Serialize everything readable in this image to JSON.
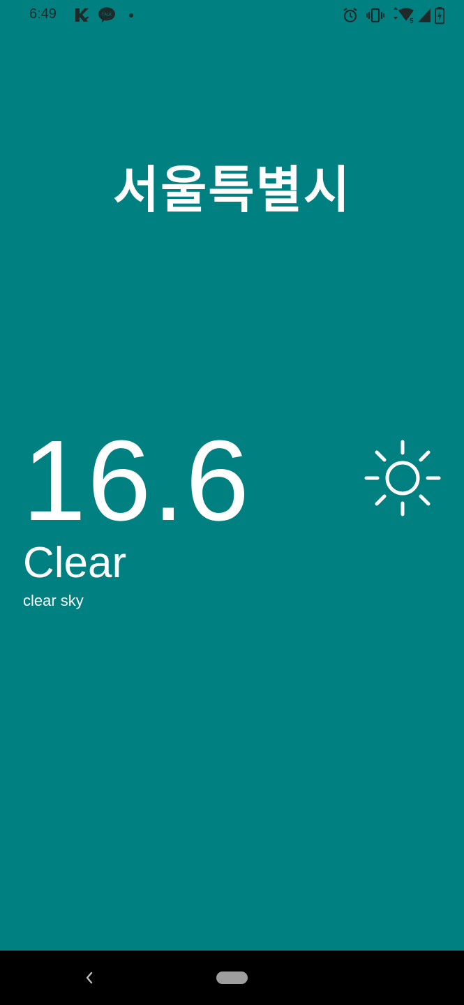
{
  "status_bar": {
    "time": "6:49",
    "left_icons": [
      "k-app-icon",
      "kakaotalk-icon",
      "notification-dot-icon"
    ],
    "kakaotalk_label": "TALK",
    "right_icons": [
      "alarm-icon",
      "vibrate-icon",
      "wifi-icon",
      "cell-signal-icon",
      "battery-icon"
    ]
  },
  "weather": {
    "city": "서울특별시",
    "temperature": "16.6",
    "condition": "Clear",
    "description": "clear sky",
    "icon": "sun-icon"
  },
  "colors": {
    "background": "#008080",
    "text": "#ffffff",
    "status_icons": "#1e2a2a",
    "nav_bar": "#000000"
  },
  "nav_bar": {
    "buttons": [
      "back-icon",
      "home-pill"
    ]
  }
}
